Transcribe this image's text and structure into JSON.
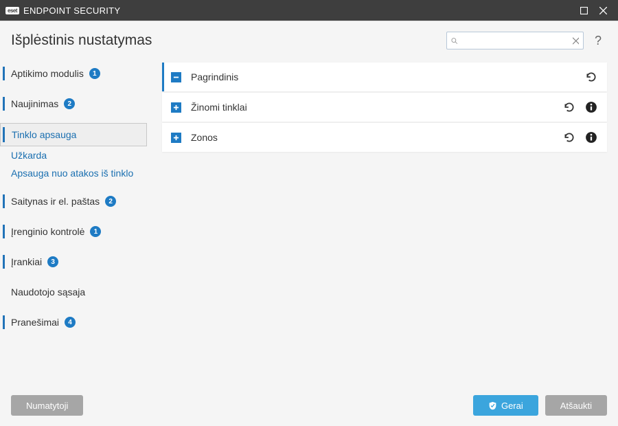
{
  "titlebar": {
    "brand_prefix": "eset",
    "brand_text": "ENDPOINT SECURITY"
  },
  "header": {
    "title": "Išplėstinis nustatymas",
    "search_placeholder": ""
  },
  "sidebar": {
    "items": [
      {
        "label": "Aptikimo modulis",
        "badge": "1"
      },
      {
        "label": "Naujinimas",
        "badge": "2"
      },
      {
        "label": "Tinklo apsauga"
      },
      {
        "label": "Saitynas ir el. paštas",
        "badge": "2"
      },
      {
        "label": "Įrenginio kontrolė",
        "badge": "1"
      },
      {
        "label": "Įrankiai",
        "badge": "3"
      },
      {
        "label": "Naudotojo sąsaja"
      },
      {
        "label": "Pranešimai",
        "badge": "4"
      }
    ],
    "sub_items": [
      {
        "label": "Užkarda"
      },
      {
        "label": "Apsauga nuo atakos iš tinklo"
      }
    ]
  },
  "main": {
    "rows": [
      {
        "label": "Pagrindinis"
      },
      {
        "label": "Žinomi tinklai"
      },
      {
        "label": "Zonos"
      }
    ]
  },
  "footer": {
    "defaults": "Numatytoji",
    "ok": "Gerai",
    "cancel": "Atšaukti"
  }
}
